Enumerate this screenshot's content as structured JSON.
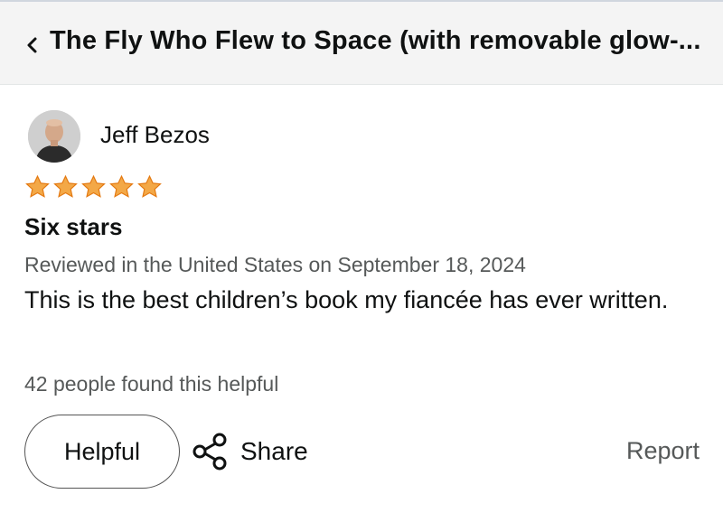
{
  "header": {
    "back_icon": "chevron-left-icon",
    "title": "The Fly Who Flew to Space (with removable glow-..."
  },
  "review": {
    "reviewer_name": "Jeff Bezos",
    "rating": 5,
    "rating_max": 5,
    "star_color": "#f3a847",
    "title": "Six stars",
    "meta": "Reviewed in the United States on September 18, 2024",
    "body": "This is the best children’s book my fiancée has ever written.",
    "helpful_count": "42 people found this helpful"
  },
  "actions": {
    "helpful_label": "Helpful",
    "share_label": "Share",
    "share_icon": "share-icon",
    "report_label": "Report"
  }
}
